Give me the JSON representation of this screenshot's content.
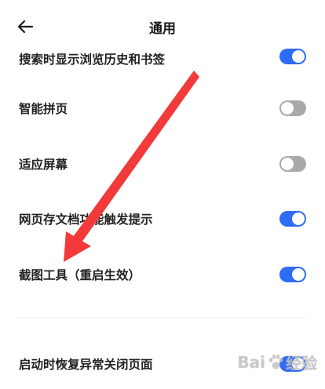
{
  "header": {
    "title": "通用"
  },
  "settings": [
    {
      "label": "搜索时显示浏览历史和书签",
      "on": true
    },
    {
      "label": "智能拼页",
      "on": false
    },
    {
      "label": "适应屏幕",
      "on": false
    },
    {
      "label": "网页存文档功能触发提示",
      "on": true
    },
    {
      "label": "截图工具（重启生效）",
      "on": true
    },
    {
      "label": "启动时恢复异常关闭页面",
      "on": true
    }
  ],
  "watermark": {
    "left": "Bai",
    "right": "经验"
  },
  "colors": {
    "toggle_on": "#2f6cf6",
    "toggle_off": "#a9a9a9",
    "annotation_arrow": "#f23a3a"
  },
  "icons": {
    "back": "arrow-left-icon",
    "watermark": "paw-icon"
  }
}
